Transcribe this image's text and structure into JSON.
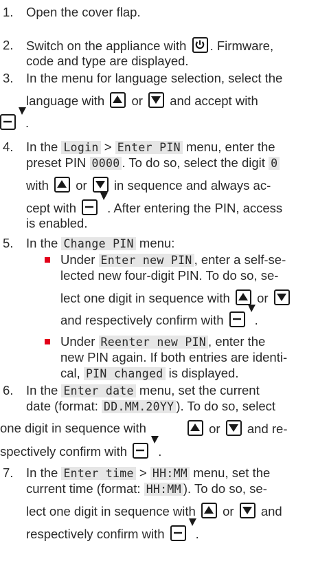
{
  "steps": [
    {
      "num": "1.",
      "line1": "Open the cover flap."
    },
    {
      "num": "2.",
      "a": "Switch on the appliance with",
      "b": ". Firmware,",
      "line2": "code and type are displayed."
    },
    {
      "num": "3.",
      "line1": "In the menu for language selection, select the",
      "a": "language with",
      "or": "or",
      "b": "and accept with",
      "end": "."
    },
    {
      "num": "4.",
      "a": "In the",
      "code1": "Login",
      "gt": ">",
      "code2": "Enter PIN",
      "b": "menu, enter the",
      "c": "preset PIN",
      "code3": "0000",
      "d": ". To do so, select the digit",
      "code4": "0",
      "e": "with",
      "or": "or",
      "f": "in sequence and always ac-",
      "g": "cept with",
      "h": ". After entering the PIN, access",
      "line5": "is enabled."
    },
    {
      "num": "5.",
      "a": "In the",
      "code1": "Change PIN",
      "b": "menu:"
    },
    {
      "num": "6.",
      "a": "In the",
      "code1": "Enter date",
      "b": "menu, set the current",
      "c": "date (format:",
      "code2": "DD.MM.20YY",
      "d": "). To do so, select",
      "e": "one digit in sequence with",
      "or": "or",
      "f": "and re-",
      "g": "spectively confirm with",
      "end": "."
    },
    {
      "num": "7.",
      "a": "In the",
      "code1": "Enter time",
      "gt": ">",
      "code2": "HH:MM",
      "b": "menu, set the",
      "c": "current time (format:",
      "code3": "HH:MM",
      "d": "). To do so, se-",
      "e": "lect one digit in sequence with",
      "or": "or",
      "f": "and",
      "g": "respectively confirm with",
      "end": "."
    }
  ],
  "bullets": [
    {
      "a": "Under",
      "code1": "Enter new PIN",
      "b": ", enter a self-se-",
      "line2": "lected new four-digit PIN. To do so, se-",
      "c": "lect one digit in sequence with",
      "or": "or",
      "d": "and respectively confirm with",
      "end": "."
    },
    {
      "a": "Under",
      "code1": "Reenter new PIN",
      "b": ", enter the",
      "line2": "new PIN again. If both entries are identi-",
      "c": "cal,",
      "code2": "PIN changed",
      "d": "is displayed."
    }
  ],
  "icons": {
    "power": "power-key-icon",
    "up": "up-arrow-key-icon",
    "down": "down-arrow-key-icon",
    "ok": "ok-enter-key-icon",
    "bullet_color": "#e2001a"
  }
}
